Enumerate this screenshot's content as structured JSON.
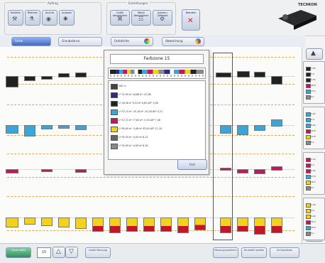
{
  "toolbar": {
    "groups": [
      {
        "title": "Auftrag",
        "buttons": [
          "Farbkiller",
          "Bildchen",
          "Ansicht",
          "Auswahl"
        ],
        "icons": [
          "⚒",
          "⚗",
          "◉",
          "✱"
        ]
      },
      {
        "title": "Einstellungen",
        "buttons": [
          "Grafik abspeichern",
          "Werte übernehmen",
          "System / Software"
        ],
        "icons": [
          "⌘",
          "☷",
          "⚙"
        ]
      },
      {
        "title": "",
        "buttons": [
          "Beenden"
        ],
        "icons": [
          "✕"
        ]
      }
    ],
    "logo": "TECHKON"
  },
  "tabs": [
    {
      "label": "Farbe",
      "active": true
    },
    {
      "label": "Graubalance",
      "active": false
    },
    {
      "label": "Farbdichte",
      "active": false
    },
    {
      "label": "Abweichung",
      "active": false
    }
  ],
  "dialog": {
    "title": "Farbzone 15",
    "ok_label": "Fort",
    "rows": [
      {
        "color": "#444444",
        "text": "100 %"
      },
      {
        "color": "#2e2c7e",
        "text": "L* 32,99  a* 18,68  b* -47,86"
      },
      {
        "color": "#222222",
        "text": "L* 16,36  a* 0,52  b* 0,63  ΔE* 3,08"
      },
      {
        "color": "#3aa6d8",
        "text": "L* 53,74  a* -35,18  b* -50,30  ΔE* 3,21"
      },
      {
        "color": "#c2185b",
        "text": "L* 47,72  a* 77,62  b* -5,30  ΔE* 7,46"
      },
      {
        "color": "#f2d21b",
        "text": "L* 89,09  a* -5,06  b* 93,09  ΔE* 11,10"
      },
      {
        "color": "#666666",
        "text": "L* 95,45  a* -0,05  b* 6,14"
      },
      {
        "color": "#888888",
        "text": "L* 95,99  a* -0,09  b* 6,16"
      }
    ]
  },
  "side_panels": [
    {
      "values": [
        "1,82",
        "0,0",
        "0,05",
        "26,8",
        "15,2",
        "0,1"
      ]
    },
    {
      "values": [
        "1,22",
        "0,0",
        "0,04",
        "26,8",
        "23,8",
        "0,1"
      ]
    },
    {
      "values": [
        "1,23",
        "0,0",
        "0,02",
        "27,9",
        "18,3",
        "0,1"
      ]
    },
    {
      "values": [
        "1,00",
        "0,0",
        "0,04",
        "35,3",
        "26,6",
        "0,1"
      ]
    }
  ],
  "bottom": {
    "zone_label": "Zonen Wahl",
    "page_value": "15",
    "buttons": [
      "Letzte Messung",
      "Messung speichern",
      "Druckbild senden",
      "Zurücksetzen"
    ]
  },
  "colors": {
    "accent": "#3f67c7",
    "dash": "#d9a85f"
  }
}
